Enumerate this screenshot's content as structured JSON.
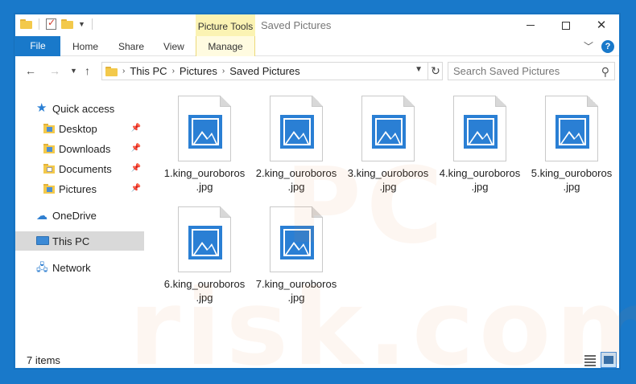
{
  "window": {
    "title": "Saved Pictures",
    "contextual_group": "Picture Tools",
    "accent_color": "#1979ca"
  },
  "ribbon": {
    "tabs": [
      {
        "label": "File"
      },
      {
        "label": "Home"
      },
      {
        "label": "Share"
      },
      {
        "label": "View"
      },
      {
        "label": "Manage"
      }
    ],
    "help_label": "?"
  },
  "address": {
    "crumbs": [
      "This PC",
      "Pictures",
      "Saved Pictures"
    ]
  },
  "search": {
    "placeholder": "Search Saved Pictures"
  },
  "sidebar": {
    "items": [
      {
        "label": "Quick access",
        "icon": "star-icon"
      },
      {
        "label": "Desktop",
        "icon": "folder-icon",
        "pinned": true
      },
      {
        "label": "Downloads",
        "icon": "folder-icon",
        "pinned": true
      },
      {
        "label": "Documents",
        "icon": "folder-icon",
        "pinned": true
      },
      {
        "label": "Pictures",
        "icon": "folder-icon",
        "pinned": true
      },
      {
        "label": "OneDrive",
        "icon": "cloud-icon"
      },
      {
        "label": "This PC",
        "icon": "computer-icon",
        "selected": true
      },
      {
        "label": "Network",
        "icon": "network-icon"
      }
    ]
  },
  "files": [
    {
      "line1": "1.king_ouroboros",
      "line2": ".jpg"
    },
    {
      "line1": "2.king_ouroboros",
      "line2": ".jpg"
    },
    {
      "line1": "3.king_ouroboros",
      "line2": ".jpg"
    },
    {
      "line1": "4.king_ouroboros",
      "line2": ".jpg"
    },
    {
      "line1": "5.king_ouroboros",
      "line2": ".jpg"
    },
    {
      "line1": "6.king_ouroboros",
      "line2": ".jpg"
    },
    {
      "line1": "7.king_ouroboros",
      "line2": ".jpg"
    }
  ],
  "status": {
    "item_count": "7 items"
  },
  "watermark": {
    "text": "PC risk.com"
  }
}
